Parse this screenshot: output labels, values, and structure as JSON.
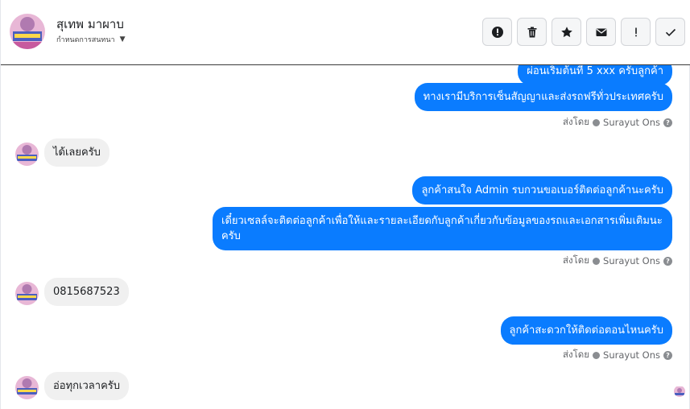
{
  "header": {
    "name": "สุเทพ มาผาบ",
    "assign_label": "กำหนดการสนทนา",
    "buttons": [
      {
        "name": "mark-spam-button",
        "icon": "alert-circle-icon"
      },
      {
        "name": "delete-button",
        "icon": "trash-icon"
      },
      {
        "name": "star-button",
        "icon": "star-icon"
      },
      {
        "name": "mark-unread-button",
        "icon": "envelope-icon"
      },
      {
        "name": "follow-up-button",
        "icon": "exclamation-icon"
      },
      {
        "name": "mark-done-button",
        "icon": "check-icon"
      }
    ]
  },
  "messages": [
    {
      "side": "out",
      "text": "ผ่อนเริ่มต้นที่ 5 xxx ครับลูกค้า"
    },
    {
      "side": "out",
      "text": "ทางเรามีบริการเซ็นสัญญาและส่งรถฟรีทั่วประเทศครับ"
    },
    {
      "side": "meta",
      "label": "ส่งโดย",
      "sender": "Surayut Ons"
    },
    {
      "side": "in",
      "text": "ได้เลยครับ"
    },
    {
      "side": "out",
      "text": "ลูกค้าสนใจ Admin รบกวนขอเบอร์ติดต่อลูกค้านะครับ"
    },
    {
      "side": "out",
      "text": "เดี๋ยวเซลล์จะติดต่อลูกค้าเพื่อให้และรายละเอียดกับลูกค้าเกี่ยวกับข้อมูลของรถและเอกสารเพิ่มเติมนะครับ"
    },
    {
      "side": "meta",
      "label": "ส่งโดย",
      "sender": "Surayut Ons"
    },
    {
      "side": "in",
      "text": "0815687523"
    },
    {
      "side": "out",
      "text": "ลูกค้าสะดวกให้ติดต่อตอนไหนครับ"
    },
    {
      "side": "meta",
      "label": "ส่งโดย",
      "sender": "Surayut Ons"
    },
    {
      "side": "in",
      "text": "อ่อทุกเวลาครับ"
    }
  ],
  "colors": {
    "outgoing_bubble": "#0a7cff",
    "incoming_bubble": "#f0f0f0",
    "meta_text": "#65676b"
  }
}
